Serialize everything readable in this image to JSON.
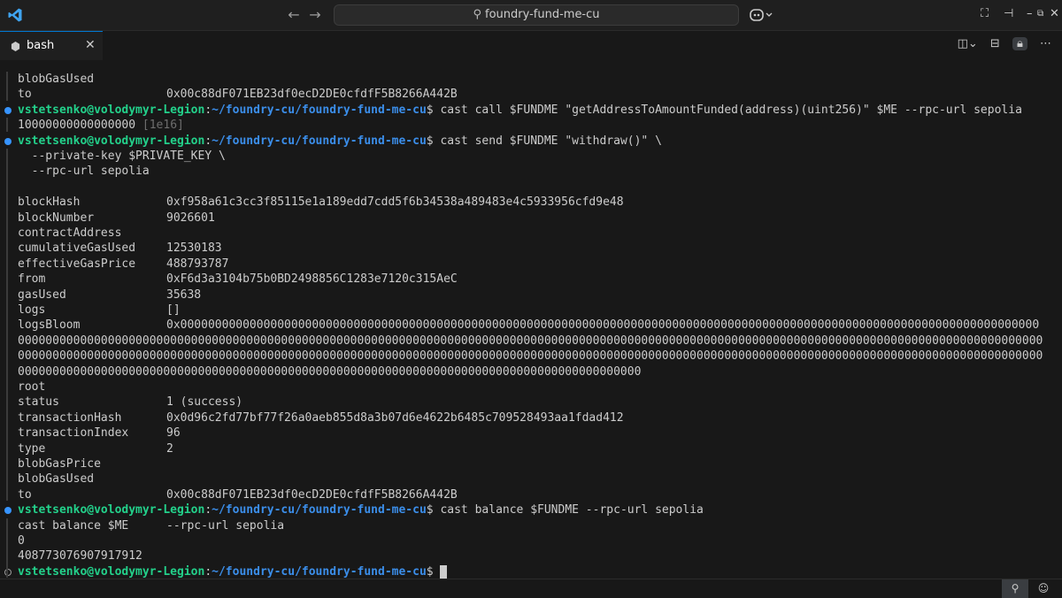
{
  "titlebar": {
    "search_text": "foundry-fund-me-cu"
  },
  "tab": {
    "label": "bash",
    "close": "✕"
  },
  "terminal": {
    "lines": [
      {
        "key": "blobGasUsed",
        "value": ""
      },
      {
        "key": "to",
        "value": "0x00c88dF071EB23df0ecD2DE0cfdfF5B8266A442B"
      },
      {
        "prompt_user": "vstetsenko@volodymyr-Legion",
        "prompt_path": "~/foundry-cu/foundry-fund-me-cu",
        "cmd": " cast call $FUNDME \"getAddressToAmountFunded(address)(uint256)\" $ME --rpc-url sepolia"
      },
      {
        "text": "10000000000000000",
        "dim": " [1e16]"
      },
      {
        "prompt_user": "vstetsenko@volodymyr-Legion",
        "prompt_path": "~/foundry-cu/foundry-fund-me-cu",
        "cmd": " cast send $FUNDME \"withdraw()\" \\"
      },
      {
        "text": "  --private-key $PRIVATE_KEY \\"
      },
      {
        "text": "  --rpc-url sepolia"
      },
      {
        "text": ""
      },
      {
        "key": "blockHash",
        "value": "0xf958a61c3cc3f85115e1a189edd7cdd5f6b34538a489483e4c5933956cfd9e48"
      },
      {
        "key": "blockNumber",
        "value": "9026601"
      },
      {
        "key": "contractAddress",
        "value": ""
      },
      {
        "key": "cumulativeGasUsed",
        "value": "12530183"
      },
      {
        "key": "effectiveGasPrice",
        "value": "488793787"
      },
      {
        "key": "from",
        "value": "0xF6d3a3104b75b0BD2498856C1283e7120c315AeC"
      },
      {
        "key": "gasUsed",
        "value": "35638"
      },
      {
        "key": "logs",
        "value": "[]"
      },
      {
        "key": "logsBloom",
        "value": "0x0000000000000000000000000000000000000000000000000000000000000000000000000000000000000000000000000000000000000000000000000000"
      },
      {
        "text": "0000000000000000000000000000000000000000000000000000000000000000000000000000000000000000000000000000000000000000000000000000000000000000000000000000"
      },
      {
        "text": "0000000000000000000000000000000000000000000000000000000000000000000000000000000000000000000000000000000000000000000000000000000000000000000000000000"
      },
      {
        "text": "000000000000000000000000000000000000000000000000000000000000000000000000000000000000000000"
      },
      {
        "key": "root",
        "value": ""
      },
      {
        "key": "status",
        "value": "1 (success)"
      },
      {
        "key": "transactionHash",
        "value": "0x0d96c2fd77bf77f26a0aeb855d8a3b07d6e4622b6485c709528493aa1fdad412"
      },
      {
        "key": "transactionIndex",
        "value": "96"
      },
      {
        "key": "type",
        "value": "2"
      },
      {
        "key": "blobGasPrice",
        "value": ""
      },
      {
        "key": "blobGasUsed",
        "value": ""
      },
      {
        "key": "to",
        "value": "0x00c88dF071EB23df0ecD2DE0cfdfF5B8266A442B"
      },
      {
        "prompt_user": "vstetsenko@volodymyr-Legion",
        "prompt_path": "~/foundry-cu/foundry-fund-me-cu",
        "cmd": " cast balance $FUNDME --rpc-url sepolia"
      },
      {
        "key": "cast balance $ME",
        "value": "--rpc-url sepolia"
      },
      {
        "text": "0"
      },
      {
        "text": "408773076907917912"
      },
      {
        "prompt_user": "vstetsenko@volodymyr-Legion",
        "prompt_path": "~/foundry-cu/foundry-fund-me-cu",
        "cmd": " ",
        "cursor": true
      }
    ]
  },
  "colors": {
    "user": "#23d18b",
    "path": "#3b8eea",
    "accent": "#0078d4"
  }
}
